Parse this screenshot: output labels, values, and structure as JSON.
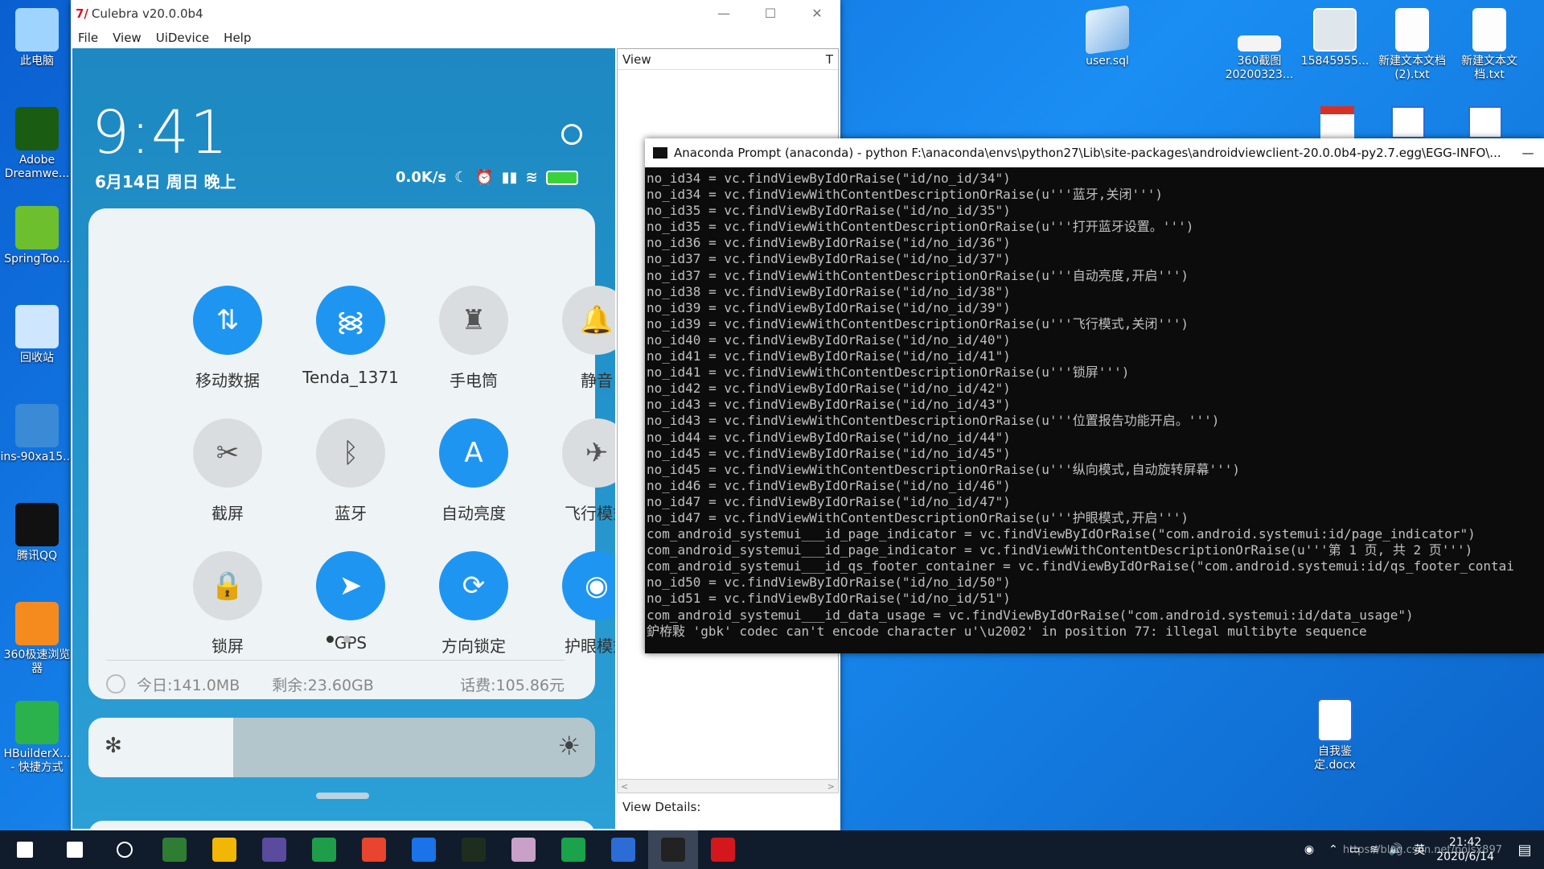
{
  "desktop": {
    "left_icons": [
      {
        "label": "此电脑",
        "icon": "computer-icon"
      },
      {
        "label": "Adobe Dreamwe...",
        "icon": "dreamweaver-icon"
      },
      {
        "label": "SpringToo...",
        "icon": "springtool-icon"
      },
      {
        "label": "回收站",
        "icon": "recycle-bin-icon"
      },
      {
        "label": "ins-90xa15...",
        "icon": "network-computer-icon"
      },
      {
        "label": "腾讯QQ",
        "icon": "qq-icon"
      },
      {
        "label": "360极速浏览器",
        "icon": "browser-360-icon"
      },
      {
        "label": "HBuilderX... - 快捷方式",
        "icon": "hbuilder-icon"
      }
    ],
    "right_icons": [
      {
        "label": "user.sql",
        "icon": "notepad-icon"
      },
      {
        "label": "360截图 20200323...",
        "icon": "screenshot-icon"
      },
      {
        "label": "15845955...",
        "icon": "photo-icon"
      },
      {
        "label": "新建文本文档 (2).txt",
        "icon": "text-file-icon"
      },
      {
        "label": "新建文本文 档.txt",
        "icon": "text-file-icon"
      },
      {
        "label": "自我鉴定.docx",
        "icon": "word-doc-icon"
      }
    ]
  },
  "culebra": {
    "title": "Culebra v20.0.0b4",
    "menu": [
      "File",
      "View",
      "UiDevice",
      "Help"
    ],
    "view_header": "View",
    "view_header_t": "T",
    "view_details": "View Details:"
  },
  "phone": {
    "time": "9:41",
    "date": "6月14日 周日 晚上",
    "net_speed": "0.0K/s",
    "tiles": [
      {
        "label": "移动数据",
        "on": true,
        "icon": "mobile-data-icon",
        "glyph": "⇅"
      },
      {
        "label": "Tenda_1371",
        "on": true,
        "icon": "wifi-icon",
        "glyph": "᯼"
      },
      {
        "label": "手电筒",
        "on": false,
        "icon": "flashlight-icon",
        "glyph": "♜"
      },
      {
        "label": "静音",
        "on": false,
        "icon": "bell-icon",
        "glyph": "🔔"
      },
      {
        "label": "截屏",
        "on": false,
        "icon": "screenshot-icon",
        "glyph": "✂"
      },
      {
        "label": "蓝牙",
        "on": false,
        "icon": "bluetooth-icon",
        "glyph": "ᛒ"
      },
      {
        "label": "自动亮度",
        "on": true,
        "icon": "auto-brightness-icon",
        "glyph": "A"
      },
      {
        "label": "飞行模式",
        "on": false,
        "icon": "airplane-icon",
        "glyph": "✈"
      },
      {
        "label": "锁屏",
        "on": false,
        "icon": "lock-icon",
        "glyph": "🔒"
      },
      {
        "label": "GPS",
        "on": true,
        "icon": "gps-icon",
        "glyph": "➤"
      },
      {
        "label": "方向锁定",
        "on": true,
        "icon": "rotation-lock-icon",
        "glyph": "⟳"
      },
      {
        "label": "护眼模式",
        "on": true,
        "icon": "eye-icon",
        "glyph": "◉"
      }
    ],
    "data_today": "今日:141.0MB",
    "data_remaining": "剩余:23.60GB",
    "balance": "话费:105.86元"
  },
  "console": {
    "title": "Anaconda Prompt (anaconda) - python  F:\\anaconda\\envs\\python27\\Lib\\site-packages\\androidviewclient-20.0.0b4-py2.7.egg\\EGG-INFO\\...",
    "lines": [
      "no_id34 = vc.findViewByIdOrRaise(\"id/no_id/34\")",
      "no_id34 = vc.findViewWithContentDescriptionOrRaise(u'''蓝牙,关闭''')",
      "no_id35 = vc.findViewByIdOrRaise(\"id/no_id/35\")",
      "no_id35 = vc.findViewWithContentDescriptionOrRaise(u'''打开蓝牙设置。''')",
      "no_id36 = vc.findViewByIdOrRaise(\"id/no_id/36\")",
      "no_id37 = vc.findViewByIdOrRaise(\"id/no_id/37\")",
      "no_id37 = vc.findViewWithContentDescriptionOrRaise(u'''自动亮度,开启''')",
      "no_id38 = vc.findViewByIdOrRaise(\"id/no_id/38\")",
      "no_id39 = vc.findViewByIdOrRaise(\"id/no_id/39\")",
      "no_id39 = vc.findViewWithContentDescriptionOrRaise(u'''飞行模式,关闭''')",
      "no_id40 = vc.findViewByIdOrRaise(\"id/no_id/40\")",
      "no_id41 = vc.findViewByIdOrRaise(\"id/no_id/41\")",
      "no_id41 = vc.findViewWithContentDescriptionOrRaise(u'''锁屏''')",
      "no_id42 = vc.findViewByIdOrRaise(\"id/no_id/42\")",
      "no_id43 = vc.findViewByIdOrRaise(\"id/no_id/43\")",
      "no_id43 = vc.findViewWithContentDescriptionOrRaise(u'''位置报告功能开启。''')",
      "no_id44 = vc.findViewByIdOrRaise(\"id/no_id/44\")",
      "no_id45 = vc.findViewByIdOrRaise(\"id/no_id/45\")",
      "no_id45 = vc.findViewWithContentDescriptionOrRaise(u'''纵向模式,自动旋转屏幕''')",
      "no_id46 = vc.findViewByIdOrRaise(\"id/no_id/46\")",
      "no_id47 = vc.findViewByIdOrRaise(\"id/no_id/47\")",
      "no_id47 = vc.findViewWithContentDescriptionOrRaise(u'''护眼模式,开启''')",
      "com_android_systemui___id_page_indicator = vc.findViewByIdOrRaise(\"com.android.systemui:id/page_indicator\")",
      "com_android_systemui___id_page_indicator = vc.findViewWithContentDescriptionOrRaise(u'''第 1 页, 共 2 页''')",
      "com_android_systemui___id_qs_footer_container = vc.findViewByIdOrRaise(\"com.android.systemui:id/qs_footer_contai",
      "no_id50 = vc.findViewByIdOrRaise(\"id/no_id/50\")",
      "no_id51 = vc.findViewByIdOrRaise(\"id/no_id/51\")",
      "com_android_systemui___id_data_usage = vc.findViewByIdOrRaise(\"com.android.systemui:id/data_usage\")",
      "鈩栫敤 'gbk' codec can't encode character u'\\u2002' in position 77: illegal multibyte sequence"
    ]
  },
  "taskbar": {
    "apps": [
      "windows-start-icon",
      "search-icon",
      "cortana-icon",
      "code-editor-icon",
      "file-explorer-icon",
      "eclipse-icon",
      "wps-sheet-icon",
      "chrome-icon",
      "edge-icon",
      "pycharm-icon",
      "app-icon",
      "hbuilder-icon",
      "word-icon",
      "terminal-icon",
      "culebra-icon"
    ],
    "ime": "英",
    "time": "21:42",
    "date": "2020/6/14",
    "watermark": "https://blog.csdn.net/poisx897"
  }
}
